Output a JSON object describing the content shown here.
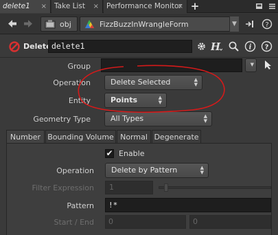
{
  "tabs": [
    {
      "label": "delete1",
      "close": "×"
    },
    {
      "label": "Take List",
      "close": "×"
    },
    {
      "label": "Performance Monitor",
      "close": "×"
    }
  ],
  "tabbar": {
    "plus": "+"
  },
  "path": {
    "context": "obj",
    "node": "FizzBuzzInWrangleForm"
  },
  "node": {
    "type_label": "Delete",
    "name": "delete1"
  },
  "params": {
    "group": {
      "label": "Group",
      "value": ""
    },
    "operation": {
      "label": "Operation",
      "value": "Delete Selected"
    },
    "entity": {
      "label": "Entity",
      "value": "Points"
    },
    "geometry_type": {
      "label": "Geometry Type",
      "value": "All Types"
    }
  },
  "subtabs": [
    {
      "label": "Number"
    },
    {
      "label": "Bounding Volume"
    },
    {
      "label": "Normal"
    },
    {
      "label": "Degenerate"
    }
  ],
  "number_tab": {
    "enable": {
      "label": "Enable",
      "checked": true,
      "check_glyph": "✔"
    },
    "operation": {
      "label": "Operation",
      "value": "Delete by Pattern"
    },
    "filter_expression": {
      "label": "Filter Expression",
      "value": "1"
    },
    "pattern": {
      "label": "Pattern",
      "value": "!*"
    },
    "start_end": {
      "label": "Start / End",
      "start": "0",
      "end": "0"
    }
  },
  "colors": {
    "annotation": "#d61a1a",
    "delete_icon": "#d83030",
    "wrangle_icon_green": "#3cb44b"
  }
}
